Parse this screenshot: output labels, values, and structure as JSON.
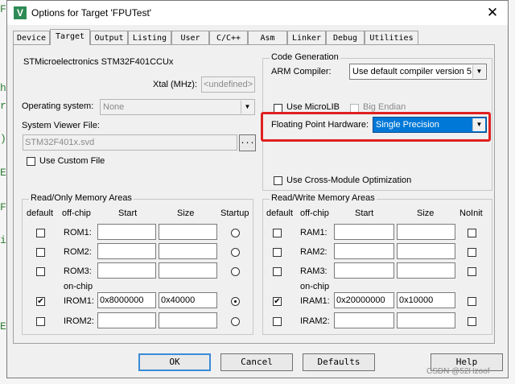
{
  "dialog": {
    "title": "Options for Target 'FPUTest'",
    "close_icon": "close-icon",
    "app_icon": "keil-uvision-icon"
  },
  "tabs": [
    "Device",
    "Target",
    "Output",
    "Listing",
    "User",
    "C/C++",
    "Asm",
    "Linker",
    "Debug",
    "Utilities"
  ],
  "active_tab": "Target",
  "target": {
    "device_name": "STMicroelectronics STM32F401CCUx",
    "xtal_label": "Xtal (MHz):",
    "xtal_value": "<undefined>",
    "os_label": "Operating system:",
    "os_value": "None",
    "svf_label": "System Viewer File:",
    "svf_value": "STM32F401x.svd",
    "browse_label": "...",
    "custom_file_label": "Use Custom File"
  },
  "codegen": {
    "group_title": "Code Generation",
    "arm_compiler_label": "ARM Compiler:",
    "arm_compiler_value": "Use default compiler version 5",
    "microlib_label": "Use MicroLIB",
    "big_endian_label": "Big Endian",
    "fph_label": "Floating Point Hardware:",
    "fph_value": "Single Precision",
    "cross_module_label": "Use Cross-Module Optimization"
  },
  "ro": {
    "group_title": "Read/Only Memory Areas",
    "headers": {
      "default": "default",
      "offchip": "off-chip",
      "start": "Start",
      "size": "Size",
      "startup": "Startup"
    },
    "onchip_label": "on-chip",
    "rows": [
      {
        "name": "ROM1:",
        "start": "",
        "size": "",
        "default": false,
        "startup": false
      },
      {
        "name": "ROM2:",
        "start": "",
        "size": "",
        "default": false,
        "startup": false
      },
      {
        "name": "ROM3:",
        "start": "",
        "size": "",
        "default": false,
        "startup": false
      },
      {
        "name": "IROM1:",
        "start": "0x8000000",
        "size": "0x40000",
        "default": true,
        "startup": true
      },
      {
        "name": "IROM2:",
        "start": "",
        "size": "",
        "default": false,
        "startup": false
      }
    ]
  },
  "rw": {
    "group_title": "Read/Write Memory Areas",
    "headers": {
      "default": "default",
      "offchip": "off-chip",
      "start": "Start",
      "size": "Size",
      "noinit": "NoInit"
    },
    "onchip_label": "on-chip",
    "rows": [
      {
        "name": "RAM1:",
        "start": "",
        "size": "",
        "default": false
      },
      {
        "name": "RAM2:",
        "start": "",
        "size": "",
        "default": false
      },
      {
        "name": "RAM3:",
        "start": "",
        "size": "",
        "default": false
      },
      {
        "name": "IRAM1:",
        "start": "0x20000000",
        "size": "0x10000",
        "default": true
      },
      {
        "name": "IRAM2:",
        "start": "",
        "size": "",
        "default": false
      }
    ]
  },
  "buttons": {
    "ok": "OK",
    "cancel": "Cancel",
    "defaults": "Defaults",
    "help": "Help"
  },
  "watermark": "CSDN @52Hzoof",
  "background_chars": [
    "F",
    "h",
    "r",
    ")",
    "E",
    "F",
    "i",
    "E"
  ],
  "colors": {
    "highlight": "#e02020",
    "selection": "#0078d7",
    "default_button_border": "#3a8bd6"
  }
}
